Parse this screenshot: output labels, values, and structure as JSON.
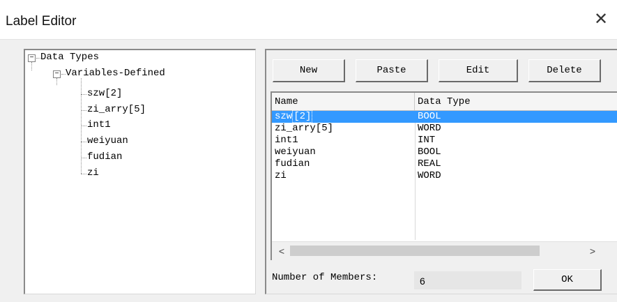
{
  "window": {
    "title": "Label Editor",
    "close_glyph": "✕"
  },
  "tree": {
    "root": {
      "label": "Data Types",
      "expander": "−"
    },
    "group": {
      "label": "Variables-Defined",
      "expander": "−"
    },
    "items": [
      "szw[2]",
      "zi_arry[5]",
      "int1",
      "weiyuan",
      "fudian",
      "zi"
    ]
  },
  "toolbar": {
    "new_label": "New",
    "paste_label": "Paste",
    "edit_label": "Edit",
    "delete_label": "Delete"
  },
  "list": {
    "columns": [
      "Name",
      "Data Type"
    ],
    "rows": [
      {
        "name_prefix": "szw",
        "name_selected_part": "[2]",
        "type": "BOOL"
      },
      {
        "name": "zi_arry[5]",
        "type": "WORD"
      },
      {
        "name": "int1",
        "type": "INT"
      },
      {
        "name": "weiyuan",
        "type": "BOOL"
      },
      {
        "name": "fudian",
        "type": "REAL"
      },
      {
        "name": "zi",
        "type": "WORD"
      }
    ],
    "selected_row": 0,
    "scroll_left_glyph": "<",
    "scroll_right_glyph": ">"
  },
  "footer": {
    "members_label": "Number of Members:",
    "members_count": "6",
    "ok_label": "OK"
  },
  "colors": {
    "selection": "#3399ff",
    "window_bg": "#f0f0f0"
  },
  "icons": [
    "tree-minus-icon",
    "close-icon",
    "scroll-left-arrow-icon",
    "scroll-right-arrow-icon"
  ]
}
